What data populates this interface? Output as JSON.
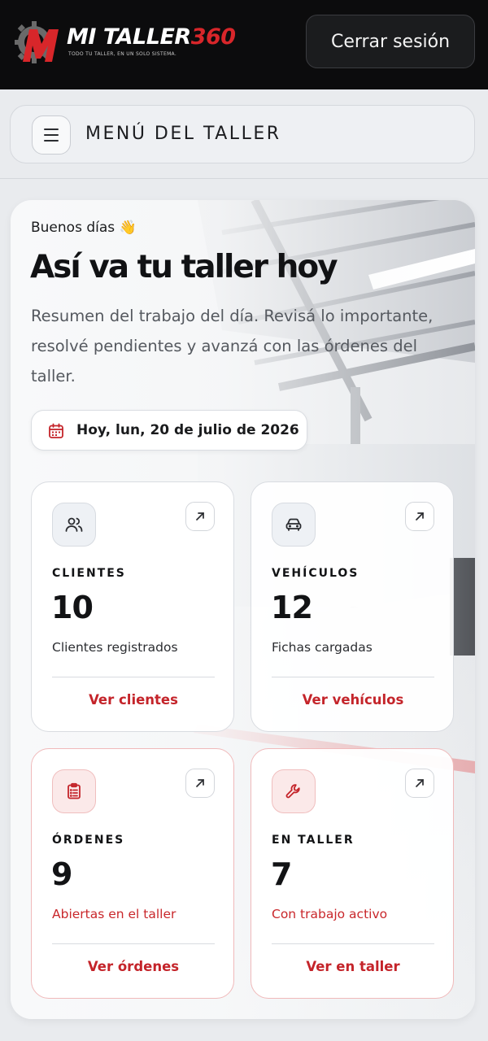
{
  "header": {
    "logo_text_primary": "MI TALLER",
    "logo_text_accent": "360",
    "logo_tagline": "TODO TU TALLER, EN UN SOLO SISTEMA.",
    "logout_label": "Cerrar sesión"
  },
  "menu": {
    "title": "MENÚ DEL TALLER",
    "icon": "hamburger-icon"
  },
  "hero": {
    "greeting": "Buenos días 👋",
    "headline": "Así va tu taller hoy",
    "description": "Resumen del trabajo del día. Revisá lo importante, resolvé pendientes y avanzá con las órdenes del taller.",
    "date": "Hoy, lun, 20 de julio de 2026",
    "date_icon": "calendar-icon"
  },
  "stats": [
    {
      "label": "CLIENTES",
      "value": "10",
      "subtitle": "Clientes registrados",
      "link": "Ver clientes",
      "icon": "users-icon",
      "alert": false
    },
    {
      "label": "VEHÍCULOS",
      "value": "12",
      "subtitle": "Fichas cargadas",
      "link": "Ver vehículos",
      "icon": "car-icon",
      "alert": false
    },
    {
      "label": "ÓRDENES",
      "value": "9",
      "subtitle": "Abiertas en el taller",
      "link": "Ver órdenes",
      "icon": "clipboard-icon",
      "alert": true
    },
    {
      "label": "EN TALLER",
      "value": "7",
      "subtitle": "Con trabajo activo",
      "link": "Ver en taller",
      "icon": "wrench-icon",
      "alert": true
    }
  ],
  "colors": {
    "accent": "#c4242a",
    "topbar": "#0c0c0d",
    "background": "#e9ebee"
  }
}
